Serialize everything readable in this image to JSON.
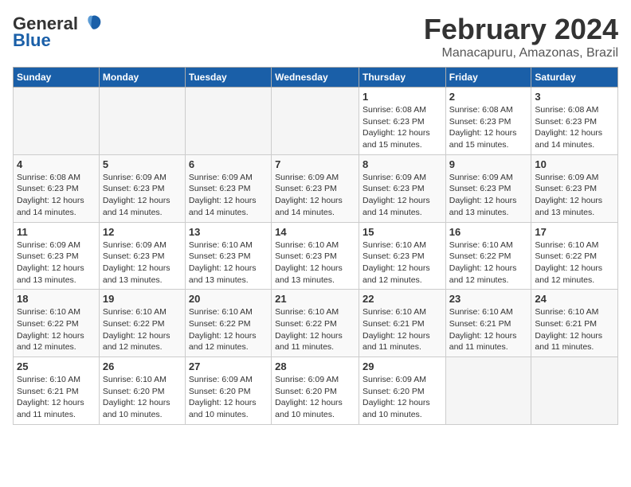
{
  "header": {
    "logo_general": "General",
    "logo_blue": "Blue",
    "title": "February 2024",
    "subtitle": "Manacapuru, Amazonas, Brazil"
  },
  "calendar": {
    "days_of_week": [
      "Sunday",
      "Monday",
      "Tuesday",
      "Wednesday",
      "Thursday",
      "Friday",
      "Saturday"
    ],
    "weeks": [
      [
        {
          "day": "",
          "info": ""
        },
        {
          "day": "",
          "info": ""
        },
        {
          "day": "",
          "info": ""
        },
        {
          "day": "",
          "info": ""
        },
        {
          "day": "1",
          "info": "Sunrise: 6:08 AM\nSunset: 6:23 PM\nDaylight: 12 hours\nand 15 minutes."
        },
        {
          "day": "2",
          "info": "Sunrise: 6:08 AM\nSunset: 6:23 PM\nDaylight: 12 hours\nand 15 minutes."
        },
        {
          "day": "3",
          "info": "Sunrise: 6:08 AM\nSunset: 6:23 PM\nDaylight: 12 hours\nand 14 minutes."
        }
      ],
      [
        {
          "day": "4",
          "info": "Sunrise: 6:08 AM\nSunset: 6:23 PM\nDaylight: 12 hours\nand 14 minutes."
        },
        {
          "day": "5",
          "info": "Sunrise: 6:09 AM\nSunset: 6:23 PM\nDaylight: 12 hours\nand 14 minutes."
        },
        {
          "day": "6",
          "info": "Sunrise: 6:09 AM\nSunset: 6:23 PM\nDaylight: 12 hours\nand 14 minutes."
        },
        {
          "day": "7",
          "info": "Sunrise: 6:09 AM\nSunset: 6:23 PM\nDaylight: 12 hours\nand 14 minutes."
        },
        {
          "day": "8",
          "info": "Sunrise: 6:09 AM\nSunset: 6:23 PM\nDaylight: 12 hours\nand 14 minutes."
        },
        {
          "day": "9",
          "info": "Sunrise: 6:09 AM\nSunset: 6:23 PM\nDaylight: 12 hours\nand 13 minutes."
        },
        {
          "day": "10",
          "info": "Sunrise: 6:09 AM\nSunset: 6:23 PM\nDaylight: 12 hours\nand 13 minutes."
        }
      ],
      [
        {
          "day": "11",
          "info": "Sunrise: 6:09 AM\nSunset: 6:23 PM\nDaylight: 12 hours\nand 13 minutes."
        },
        {
          "day": "12",
          "info": "Sunrise: 6:09 AM\nSunset: 6:23 PM\nDaylight: 12 hours\nand 13 minutes."
        },
        {
          "day": "13",
          "info": "Sunrise: 6:10 AM\nSunset: 6:23 PM\nDaylight: 12 hours\nand 13 minutes."
        },
        {
          "day": "14",
          "info": "Sunrise: 6:10 AM\nSunset: 6:23 PM\nDaylight: 12 hours\nand 13 minutes."
        },
        {
          "day": "15",
          "info": "Sunrise: 6:10 AM\nSunset: 6:23 PM\nDaylight: 12 hours\nand 12 minutes."
        },
        {
          "day": "16",
          "info": "Sunrise: 6:10 AM\nSunset: 6:22 PM\nDaylight: 12 hours\nand 12 minutes."
        },
        {
          "day": "17",
          "info": "Sunrise: 6:10 AM\nSunset: 6:22 PM\nDaylight: 12 hours\nand 12 minutes."
        }
      ],
      [
        {
          "day": "18",
          "info": "Sunrise: 6:10 AM\nSunset: 6:22 PM\nDaylight: 12 hours\nand 12 minutes."
        },
        {
          "day": "19",
          "info": "Sunrise: 6:10 AM\nSunset: 6:22 PM\nDaylight: 12 hours\nand 12 minutes."
        },
        {
          "day": "20",
          "info": "Sunrise: 6:10 AM\nSunset: 6:22 PM\nDaylight: 12 hours\nand 12 minutes."
        },
        {
          "day": "21",
          "info": "Sunrise: 6:10 AM\nSunset: 6:22 PM\nDaylight: 12 hours\nand 11 minutes."
        },
        {
          "day": "22",
          "info": "Sunrise: 6:10 AM\nSunset: 6:21 PM\nDaylight: 12 hours\nand 11 minutes."
        },
        {
          "day": "23",
          "info": "Sunrise: 6:10 AM\nSunset: 6:21 PM\nDaylight: 12 hours\nand 11 minutes."
        },
        {
          "day": "24",
          "info": "Sunrise: 6:10 AM\nSunset: 6:21 PM\nDaylight: 12 hours\nand 11 minutes."
        }
      ],
      [
        {
          "day": "25",
          "info": "Sunrise: 6:10 AM\nSunset: 6:21 PM\nDaylight: 12 hours\nand 11 minutes."
        },
        {
          "day": "26",
          "info": "Sunrise: 6:10 AM\nSunset: 6:20 PM\nDaylight: 12 hours\nand 10 minutes."
        },
        {
          "day": "27",
          "info": "Sunrise: 6:09 AM\nSunset: 6:20 PM\nDaylight: 12 hours\nand 10 minutes."
        },
        {
          "day": "28",
          "info": "Sunrise: 6:09 AM\nSunset: 6:20 PM\nDaylight: 12 hours\nand 10 minutes."
        },
        {
          "day": "29",
          "info": "Sunrise: 6:09 AM\nSunset: 6:20 PM\nDaylight: 12 hours\nand 10 minutes."
        },
        {
          "day": "",
          "info": ""
        },
        {
          "day": "",
          "info": ""
        }
      ]
    ]
  }
}
